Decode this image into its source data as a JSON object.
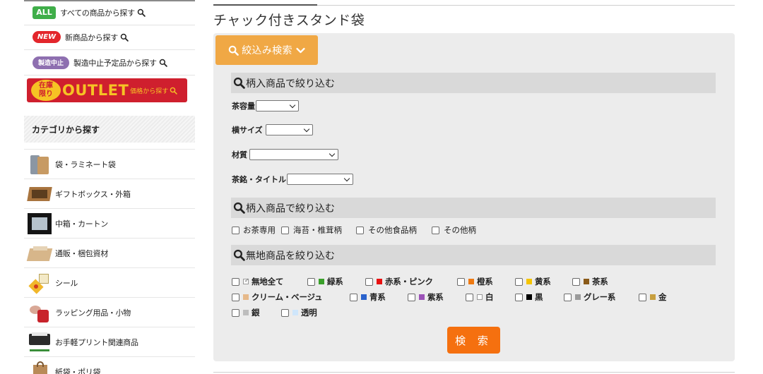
{
  "sidebar": {
    "promos": {
      "all": {
        "badge": "ALL",
        "label": "すべての商品から探す"
      },
      "new": {
        "badge": "NEW",
        "label": "新商品から探す"
      },
      "discontinued": {
        "badge": "製造中止",
        "label": "製造中止予定品から探す"
      }
    },
    "outlet": {
      "stock_line1": "在庫",
      "stock_line2": "限り",
      "word": "OUTLET",
      "sub": "価格から探す"
    },
    "category_heading": "カテゴリから探す",
    "categories": [
      {
        "label": "袋・ラミネート袋",
        "icon": "bag-icon"
      },
      {
        "label": "ギフトボックス・外箱",
        "icon": "gift-box-icon"
      },
      {
        "label": "中箱・カートン",
        "icon": "carton-icon"
      },
      {
        "label": "通販・梱包資材",
        "icon": "packing-icon"
      },
      {
        "label": "シール",
        "icon": "sticker-icon"
      },
      {
        "label": "ラッピング用品・小物",
        "icon": "wrapping-icon"
      },
      {
        "label": "お手軽プリント関連商品",
        "icon": "printer-icon"
      },
      {
        "label": "紙袋・ポリ袋",
        "icon": "paper-bag-icon"
      }
    ]
  },
  "main": {
    "title": "チャック付きスタンド袋",
    "refine_button": "絞込み検索",
    "section1": {
      "heading": "柄入商品で絞り込む",
      "fields": {
        "capacity": {
          "label": "茶容量",
          "value": ""
        },
        "width": {
          "label": "横サイズ",
          "value": ""
        },
        "material": {
          "label": "材質",
          "value": ""
        },
        "brand": {
          "label": "茶銘・タイトル",
          "value": ""
        }
      }
    },
    "section2": {
      "heading": "柄入商品で絞り込む",
      "options": [
        "お茶専用",
        "海苔・椎茸柄",
        "その他食品柄",
        "その他柄"
      ]
    },
    "section3": {
      "heading": "無地商品を絞り込む",
      "colors": [
        {
          "label": "無地全て",
          "color": "#ffffff"
        },
        {
          "label": "緑系",
          "color": "#3aa02a"
        },
        {
          "label": "赤系・ピンク",
          "color": "#e81010"
        },
        {
          "label": "橙系",
          "color": "#ef7a12"
        },
        {
          "label": "黄系",
          "color": "#f5c400"
        },
        {
          "label": "茶系",
          "color": "#8a5a18"
        },
        {
          "label": "クリーム・ベージュ",
          "color": "#e6b98a"
        },
        {
          "label": "青系",
          "color": "#2a62cc"
        },
        {
          "label": "紫系",
          "color": "#9c52b8"
        },
        {
          "label": "白",
          "color": "#ffffff"
        },
        {
          "label": "黒",
          "color": "#000000"
        },
        {
          "label": "グレー系",
          "color": "#9a9a9a"
        },
        {
          "label": "金",
          "color": "#c8a040"
        },
        {
          "label": "銀",
          "color": "#bdbdbd"
        },
        {
          "label": "透明",
          "color": "#cfe6fb"
        }
      ]
    },
    "search_button": "検 索"
  },
  "colors": {
    "accent_orange": "#f0a845",
    "search_orange": "#f5700f",
    "panel_gray": "#ececec",
    "section_gray": "#d9d9d9"
  }
}
